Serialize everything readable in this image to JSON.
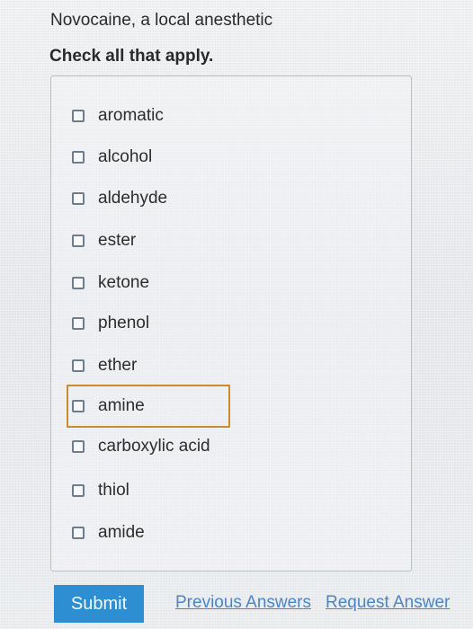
{
  "question": {
    "title": "Novocaine, a local anesthetic",
    "instruction": "Check all that apply."
  },
  "options": [
    {
      "label": "aromatic",
      "checked": false
    },
    {
      "label": "alcohol",
      "checked": false
    },
    {
      "label": "aldehyde",
      "checked": false
    },
    {
      "label": "ester",
      "checked": false
    },
    {
      "label": "ketone",
      "checked": false
    },
    {
      "label": "phenol",
      "checked": false
    },
    {
      "label": "ether",
      "checked": false
    },
    {
      "label": "amine",
      "checked": false,
      "focused": true
    },
    {
      "label": "carboxylic acid",
      "checked": false
    },
    {
      "label": "thiol",
      "checked": false
    },
    {
      "label": "amide",
      "checked": false
    }
  ],
  "actions": {
    "submit_label": "Submit",
    "previous_answers_label": "Previous Answers",
    "request_answer_label": "Request Answer"
  },
  "colors": {
    "submit_background": "#2d8fd2",
    "link": "#4c84c6",
    "focus_outline": "#d08a2e"
  }
}
